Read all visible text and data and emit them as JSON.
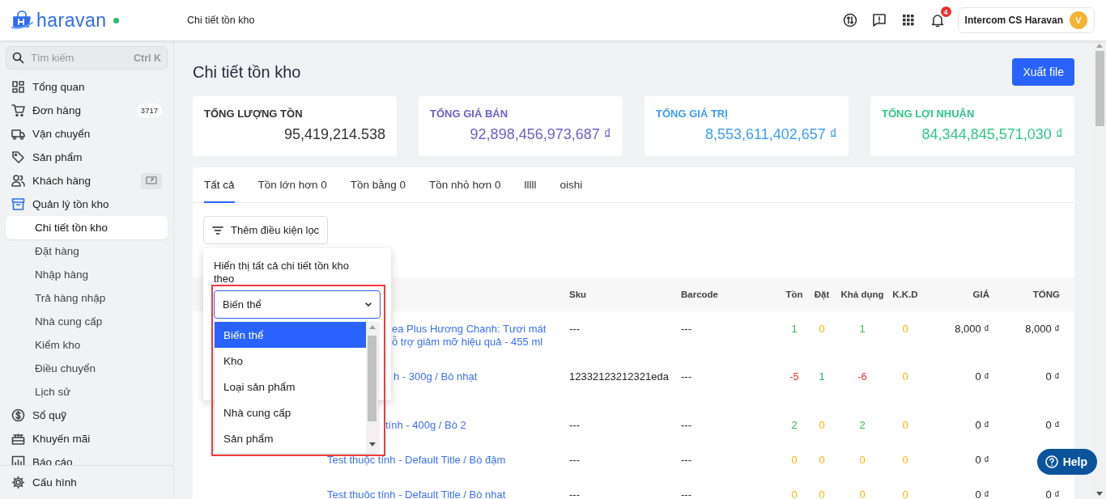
{
  "topbar": {
    "logo": "haravan",
    "online": true,
    "breadcrumb": "Chi tiết tồn kho",
    "notifications": "4",
    "user": {
      "name": "Intercom CS Haravan",
      "initial": "V"
    }
  },
  "sidebar": {
    "search": {
      "placeholder": "Tìm kiếm",
      "shortcut": "Ctrl K"
    },
    "items": [
      {
        "label": "Tổng quan"
      },
      {
        "label": "Đơn hàng",
        "badge": "3717"
      },
      {
        "label": "Vận chuyển"
      },
      {
        "label": "Sản phẩm"
      },
      {
        "label": "Khách hàng",
        "action_icon": true
      },
      {
        "label": "Quản lý tồn kho",
        "expanded": true,
        "children": [
          {
            "label": "Chi tiết tồn kho",
            "selected": true
          },
          {
            "label": "Đặt hàng",
            "selected": false
          },
          {
            "label": "Nhập hàng",
            "selected": false
          },
          {
            "label": "Trả hàng nhập",
            "selected": false
          },
          {
            "label": "Nhà cung cấp",
            "selected": false
          },
          {
            "label": "Kiểm kho",
            "selected": false
          },
          {
            "label": "Điều chuyển",
            "selected": false
          },
          {
            "label": "Lịch sử",
            "selected": false
          }
        ]
      },
      {
        "label": "Sổ quỹ"
      },
      {
        "label": "Khuyến mãi"
      },
      {
        "label": "Báo cáo"
      }
    ],
    "footer_items": [
      {
        "label": "Cấu hình"
      }
    ]
  },
  "page": {
    "title": "Chi tiết tồn kho",
    "export_button": "Xuất file"
  },
  "stats": [
    {
      "label": "TỔNG LƯỢNG TỒN",
      "value": "95,419,214.538",
      "color": "#333333"
    },
    {
      "label": "TỔNG GIÁ BÁN",
      "value": "92,898,456,973,687 ₫",
      "color": "#6b5fc8"
    },
    {
      "label": "TỔNG GIÁ TRỊ",
      "value": "8,553,611,402,657 ₫",
      "color": "#3d9cf3"
    },
    {
      "label": "TỔNG LỢI NHUẬN",
      "value": "84,344,845,571,030 ₫",
      "color": "#2fc687"
    }
  ],
  "tabs": [
    {
      "label": "Tất cả",
      "selected": true
    },
    {
      "label": "Tồn lớn hơn 0",
      "selected": false
    },
    {
      "label": "Tồn bằng 0",
      "selected": false
    },
    {
      "label": "Tồn nhỏ hơn 0",
      "selected": false
    },
    {
      "label": "lllll",
      "selected": false
    },
    {
      "label": "oishi",
      "selected": false
    }
  ],
  "filter_button": "Thêm điều kiện lọc",
  "filter_popover": {
    "prompt": "Hiển thị tất cả chi tiết tồn kho theo",
    "highlight": true,
    "select": {
      "value": "Biến thể",
      "expanded": true
    },
    "options": [
      {
        "label": "Biến thể",
        "selected": true
      },
      {
        "label": "Kho",
        "selected": false
      },
      {
        "label": "Loại sản phẩm",
        "selected": false
      },
      {
        "label": "Nhà cung cấp",
        "selected": false
      },
      {
        "label": "Sản phẩm",
        "selected": false
      }
    ]
  },
  "table": {
    "columns": [
      "Sku",
      "Barcode",
      "Tồn",
      "Đặt",
      "Khả dụng",
      "K.K.D",
      "GIÁ",
      "TỔNG"
    ],
    "rows": [
      {
        "product": [
          "ea Plus Hương Chanh: Tươi mát",
          "ỗ trợ giảm mỡ hiệu quả - 455 ml"
        ],
        "sku": "---",
        "barcode": "---",
        "quantities": [
          {
            "text": "1",
            "color": "#3ab54a"
          },
          {
            "text": "0",
            "color": "#f5b50a"
          },
          {
            "text": "1",
            "color": "#3ab54a"
          },
          {
            "text": "0",
            "color": "#f5b50a"
          }
        ],
        "price": "8,000 ₫",
        "total": "8,000 ₫"
      },
      {
        "product": [
          "h - 300g / Bò nhạt"
        ],
        "sku": "12332123212321eda",
        "barcode": "---",
        "quantities": [
          {
            "text": "-5",
            "color": "#e53935"
          },
          {
            "text": "1",
            "color": "#1fae8a"
          },
          {
            "text": "-6",
            "color": "#e53935"
          },
          {
            "text": "0",
            "color": "#f5b50a"
          }
        ],
        "price": "0 ₫",
        "total": "0 ₫"
      },
      {
        "product": [
          "tính - 400g / Bò 2"
        ],
        "sku": "---",
        "barcode": "---",
        "quantities": [
          {
            "text": "2",
            "color": "#3ab54a"
          },
          {
            "text": "0",
            "color": "#f5b50a"
          },
          {
            "text": "2",
            "color": "#3ab54a"
          },
          {
            "text": "0",
            "color": "#f5b50a"
          }
        ],
        "price": "0 ₫",
        "total": "0 ₫"
      },
      {
        "product": [
          "Test thuộc tính - Default Title / Bò đậm"
        ],
        "sku": "---",
        "barcode": "---",
        "quantities": [
          {
            "text": "0",
            "color": "#f5b50a"
          },
          {
            "text": "0",
            "color": "#f5b50a"
          },
          {
            "text": "0",
            "color": "#f5b50a"
          },
          {
            "text": "0",
            "color": "#f5b50a"
          }
        ],
        "price": "0 ₫"
      },
      {
        "product": [
          "Test thuộc tính - Default Title / Bò nhạt"
        ],
        "sku": "---",
        "barcode": "---",
        "quantities": [
          {
            "text": "0",
            "color": "#f5b50a"
          },
          {
            "text": "0",
            "color": "#f5b50a"
          },
          {
            "text": "0",
            "color": "#f5b50a"
          },
          {
            "text": "0",
            "color": "#f5b50a"
          }
        ],
        "price": "0 ₫",
        "total": "0 ₫"
      }
    ]
  },
  "help_button": "Help"
}
